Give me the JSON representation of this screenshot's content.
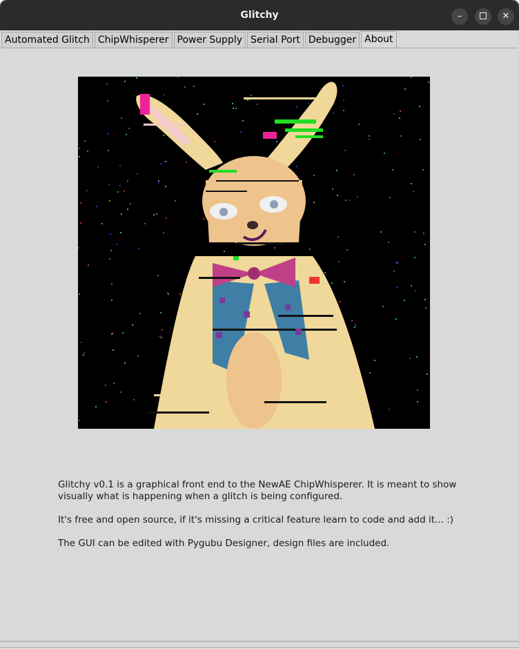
{
  "window": {
    "title": "Glitchy",
    "controls": {
      "minimize_icon": "minimize-icon",
      "maximize_icon": "maximize-icon",
      "close_icon": "close-icon"
    }
  },
  "tabs": [
    {
      "label": "Automated Glitch",
      "active": false
    },
    {
      "label": "ChipWhisperer",
      "active": false
    },
    {
      "label": "Power Supply",
      "active": false
    },
    {
      "label": "Serial Port",
      "active": false
    },
    {
      "label": "Debugger",
      "active": false
    },
    {
      "label": "About",
      "active": true
    }
  ],
  "about": {
    "image": "glitched-rabbit-artwork",
    "paragraphs": [
      "Glitchy v0.1 is a graphical front end to the NewAE ChipWhisperer. It is meant to show visually what is happening when a glitch is being configured.",
      "It's free and open source, if it's missing a critical feature learn to code and add it... :)",
      "The GUI can be edited with Pygubu Designer, design files are included."
    ]
  },
  "colors": {
    "titlebar": "#2b2b2b",
    "window_bg": "#d9d9d9",
    "art_bg": "#000000",
    "fur": "#f0d89a",
    "skin": "#eec38c",
    "vest": "#3f7fa6",
    "bowtie": "#c04088",
    "glitch_green": "#22dd22",
    "glitch_magenta": "#ee2299"
  }
}
